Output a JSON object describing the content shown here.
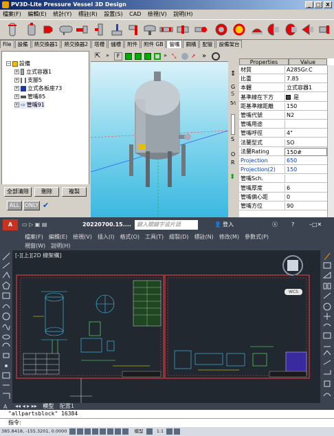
{
  "pv3d": {
    "title": "PV3D-Lite Pressure Vessel 3D Design",
    "window_buttons": [
      "_",
      "□",
      "X"
    ],
    "menu": [
      "檔案(F)",
      "編輯(E)",
      "統計(Y)",
      "標註(R)",
      "設置(S)",
      "CAD",
      "檢視(V)",
      "說明(H)"
    ],
    "tabs": [
      "File",
      "設備",
      "熱交換器1",
      "熱交換器2",
      "塔槽",
      "儲槽",
      "附件",
      "附件 GB",
      "管嘴",
      "鋼構",
      "配管",
      "設備架台"
    ],
    "tree": {
      "root": "設備",
      "items": [
        "立式容器1",
        "支腳5",
        "立式各板座73",
        "管嘴85",
        "管嘴91"
      ]
    },
    "tree_buttons": [
      "全部清除",
      "刪除",
      "複製"
    ],
    "filter_buttons": [
      "ALL",
      "ONLY"
    ],
    "view_markers": [
      "F"
    ],
    "side_buttons": [
      "G",
      "S",
      "S",
      "O",
      "R"
    ],
    "properties": {
      "headers": [
        "Properties",
        "Value"
      ],
      "rows": [
        {
          "key": "材質",
          "value": "A285Gr.C"
        },
        {
          "key": "比重",
          "value": "7.85"
        },
        {
          "key": "本體",
          "value": "立式容器1"
        },
        {
          "key": "基準線在下方",
          "value": "是"
        },
        {
          "key": "距基準線距離",
          "value": "150"
        },
        {
          "key": "管嘴代號",
          "value": "N2"
        },
        {
          "key": "管嘴用途",
          "value": ""
        },
        {
          "key": "管嘴呼徑",
          "value": "4\""
        },
        {
          "key": "法蘭型式",
          "value": "SO"
        },
        {
          "key": "法蘭Rating",
          "value": "150#"
        },
        {
          "key": "Projection",
          "value": "650"
        },
        {
          "key": "Projection(2)",
          "value": "150"
        },
        {
          "key": "管嘴Sch.",
          "value": ""
        },
        {
          "key": "管嘴厚度",
          "value": "6"
        },
        {
          "key": "管嘴偏心距",
          "value": "0"
        },
        {
          "key": "管嘴方位",
          "value": "90"
        }
      ]
    }
  },
  "cad": {
    "doc_name": "20220700.15....",
    "search_placeholder": "鍵入關鍵字或片語",
    "signin": "登入",
    "menu_row1": [
      "檔案(F)",
      "編輯(E)",
      "檢視(V)",
      "插入(I)",
      "格式(O)",
      "工具(T)",
      "繪製(D)",
      "標註(N)",
      "修改(M)",
      "參數式(P)"
    ],
    "menu_row2": [
      "視窗(W)",
      "說明(H)"
    ],
    "viewport_label": "[-][上][2D 線架構]",
    "viewcube_label": "上",
    "wcs": "WCS",
    "layout_tabs": [
      "模型",
      "配置1"
    ],
    "cmd_history": "\"allpartsblock\" 16384",
    "cmd_prompt": "指令:",
    "coords": "385.8418, -155.3201, 0.0000",
    "status_items": [
      "模型",
      "1:1"
    ]
  },
  "colors": {
    "pv3d_bg": "#d4d0c8",
    "sky": "#7fd4ec",
    "cad_bg": "#212830",
    "sheet_border": "#ff3b3b",
    "cad_accent": "#e85a2a"
  }
}
